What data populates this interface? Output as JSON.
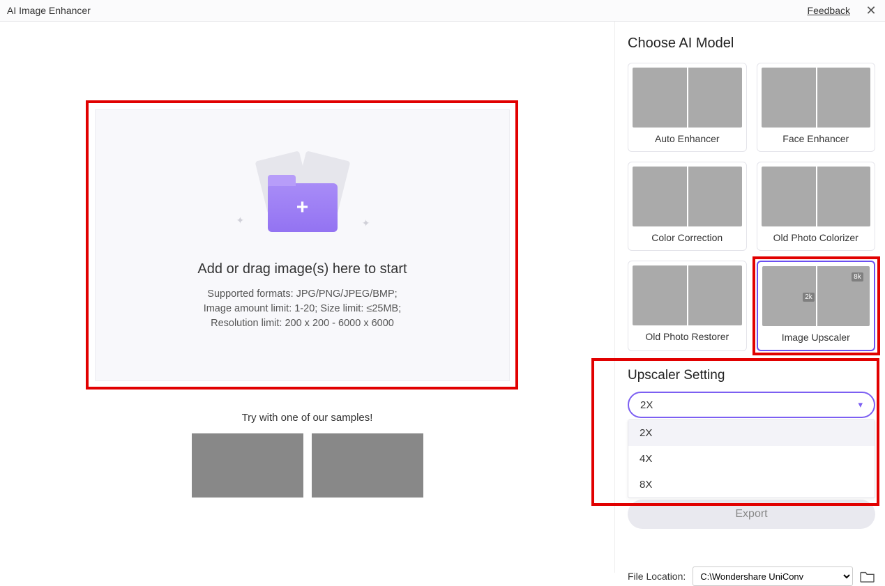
{
  "titlebar": {
    "title": "AI Image Enhancer",
    "feedback": "Feedback"
  },
  "dropzone": {
    "heading": "Add or drag image(s) here to start",
    "line1": "Supported formats: JPG/PNG/JPEG/BMP;",
    "line2": "Image amount limit: 1-20; Size limit: ≤25MB;",
    "line3": "Resolution limit: 200 x 200 - 6000 x 6000"
  },
  "samples": {
    "label": "Try with one of our samples!"
  },
  "panel": {
    "choose_model": "Choose AI Model",
    "models": [
      {
        "label": "Auto Enhancer"
      },
      {
        "label": "Face Enhancer"
      },
      {
        "label": "Color Correction"
      },
      {
        "label": "Old Photo Colorizer"
      },
      {
        "label": "Old Photo Restorer"
      },
      {
        "label": "Image Upscaler"
      }
    ],
    "upscaler_heading": "Upscaler Setting",
    "upscale_selected": "2X",
    "upscale_options": [
      "2X",
      "4X",
      "8X"
    ],
    "upscale_tag_2k": "2k",
    "upscale_tag_8k": "8k",
    "export": "Export",
    "file_location_label": "File Location:",
    "file_location_value": "C:\\Wondershare UniConv"
  }
}
